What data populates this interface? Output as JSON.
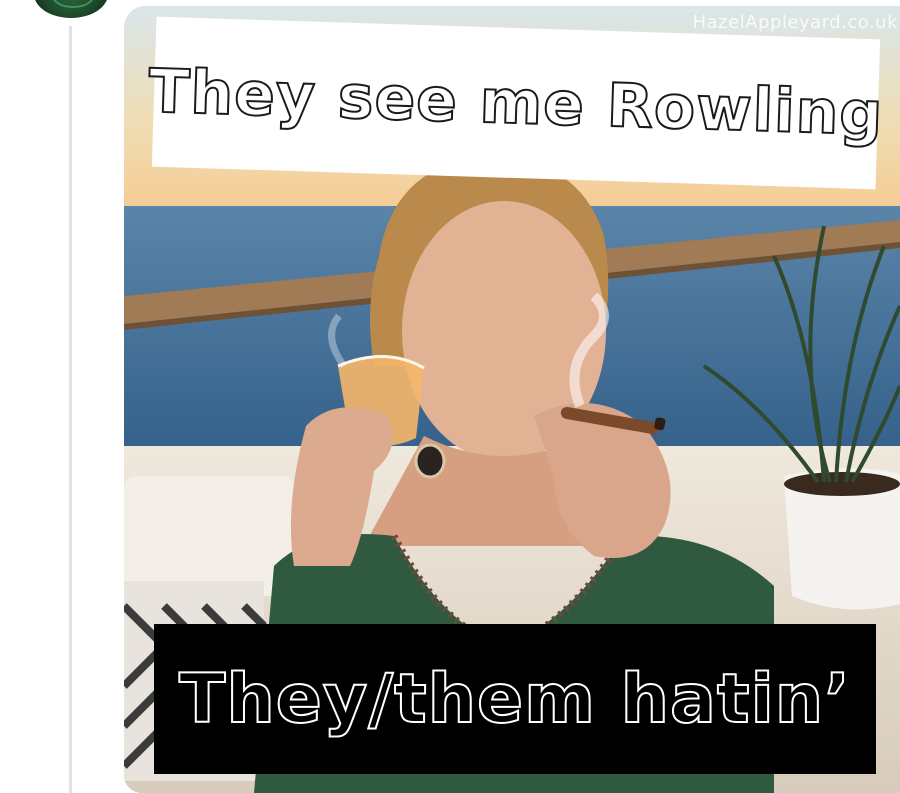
{
  "post": {
    "avatar_icon": "profile-avatar-icon",
    "media": {
      "watermark": "HazelAppleyard.co.uk",
      "top_caption": "They see me Rowling",
      "bottom_caption": "They/them hatin’"
    }
  },
  "colors": {
    "sky": "#f2d8a6",
    "sea": "#3f6f96",
    "railing": "#9b7a55",
    "top_caption_bg": "#ffffff",
    "bottom_caption_bg": "#000000"
  }
}
